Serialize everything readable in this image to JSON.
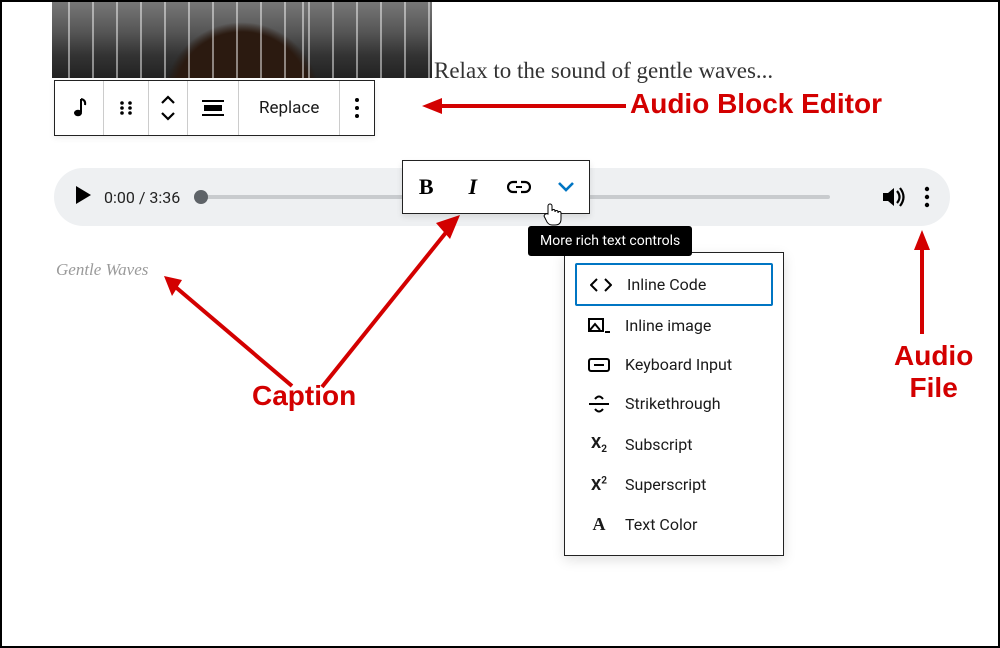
{
  "description": "Relax to the sound of gentle waves...",
  "block_toolbar": {
    "replace_label": "Replace"
  },
  "player": {
    "current_time": "0:00",
    "duration": "3:36"
  },
  "caption_toolbar": {
    "bold_label": "B",
    "italic_label": "I"
  },
  "tooltip": "More rich text controls",
  "caption_text": "Gentle Waves",
  "dropdown": {
    "items": [
      {
        "label": "Inline Code"
      },
      {
        "label": "Inline image"
      },
      {
        "label": "Keyboard Input"
      },
      {
        "label": "Strikethrough"
      },
      {
        "label": "Subscript"
      },
      {
        "label": "Superscript"
      },
      {
        "label": "Text Color"
      }
    ]
  },
  "annotations": {
    "audio_block_editor": "Audio Block Editor",
    "caption": "Caption",
    "audio_file_line1": "Audio",
    "audio_file_line2": "File"
  },
  "colors": {
    "annotation_red": "#d30000",
    "link_blue": "#0075c3"
  }
}
